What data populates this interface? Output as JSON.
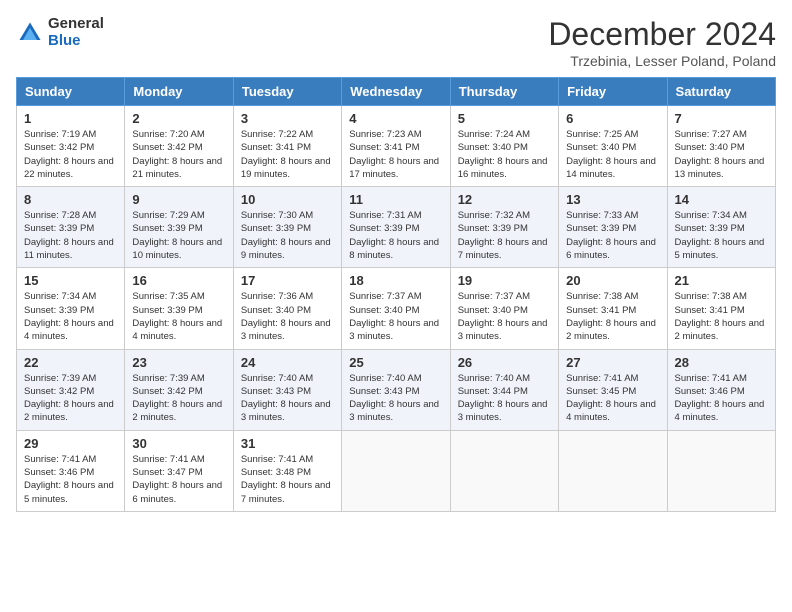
{
  "logo": {
    "general": "General",
    "blue": "Blue"
  },
  "title": "December 2024",
  "location": "Trzebinia, Lesser Poland, Poland",
  "days_of_week": [
    "Sunday",
    "Monday",
    "Tuesday",
    "Wednesday",
    "Thursday",
    "Friday",
    "Saturday"
  ],
  "weeks": [
    [
      {
        "day": 1,
        "sunrise": "7:19 AM",
        "sunset": "3:42 PM",
        "daylight": "8 hours and 22 minutes."
      },
      {
        "day": 2,
        "sunrise": "7:20 AM",
        "sunset": "3:42 PM",
        "daylight": "8 hours and 21 minutes."
      },
      {
        "day": 3,
        "sunrise": "7:22 AM",
        "sunset": "3:41 PM",
        "daylight": "8 hours and 19 minutes."
      },
      {
        "day": 4,
        "sunrise": "7:23 AM",
        "sunset": "3:41 PM",
        "daylight": "8 hours and 17 minutes."
      },
      {
        "day": 5,
        "sunrise": "7:24 AM",
        "sunset": "3:40 PM",
        "daylight": "8 hours and 16 minutes."
      },
      {
        "day": 6,
        "sunrise": "7:25 AM",
        "sunset": "3:40 PM",
        "daylight": "8 hours and 14 minutes."
      },
      {
        "day": 7,
        "sunrise": "7:27 AM",
        "sunset": "3:40 PM",
        "daylight": "8 hours and 13 minutes."
      }
    ],
    [
      {
        "day": 8,
        "sunrise": "7:28 AM",
        "sunset": "3:39 PM",
        "daylight": "8 hours and 11 minutes."
      },
      {
        "day": 9,
        "sunrise": "7:29 AM",
        "sunset": "3:39 PM",
        "daylight": "8 hours and 10 minutes."
      },
      {
        "day": 10,
        "sunrise": "7:30 AM",
        "sunset": "3:39 PM",
        "daylight": "8 hours and 9 minutes."
      },
      {
        "day": 11,
        "sunrise": "7:31 AM",
        "sunset": "3:39 PM",
        "daylight": "8 hours and 8 minutes."
      },
      {
        "day": 12,
        "sunrise": "7:32 AM",
        "sunset": "3:39 PM",
        "daylight": "8 hours and 7 minutes."
      },
      {
        "day": 13,
        "sunrise": "7:33 AM",
        "sunset": "3:39 PM",
        "daylight": "8 hours and 6 minutes."
      },
      {
        "day": 14,
        "sunrise": "7:34 AM",
        "sunset": "3:39 PM",
        "daylight": "8 hours and 5 minutes."
      }
    ],
    [
      {
        "day": 15,
        "sunrise": "7:34 AM",
        "sunset": "3:39 PM",
        "daylight": "8 hours and 4 minutes."
      },
      {
        "day": 16,
        "sunrise": "7:35 AM",
        "sunset": "3:39 PM",
        "daylight": "8 hours and 4 minutes."
      },
      {
        "day": 17,
        "sunrise": "7:36 AM",
        "sunset": "3:40 PM",
        "daylight": "8 hours and 3 minutes."
      },
      {
        "day": 18,
        "sunrise": "7:37 AM",
        "sunset": "3:40 PM",
        "daylight": "8 hours and 3 minutes."
      },
      {
        "day": 19,
        "sunrise": "7:37 AM",
        "sunset": "3:40 PM",
        "daylight": "8 hours and 3 minutes."
      },
      {
        "day": 20,
        "sunrise": "7:38 AM",
        "sunset": "3:41 PM",
        "daylight": "8 hours and 2 minutes."
      },
      {
        "day": 21,
        "sunrise": "7:38 AM",
        "sunset": "3:41 PM",
        "daylight": "8 hours and 2 minutes."
      }
    ],
    [
      {
        "day": 22,
        "sunrise": "7:39 AM",
        "sunset": "3:42 PM",
        "daylight": "8 hours and 2 minutes."
      },
      {
        "day": 23,
        "sunrise": "7:39 AM",
        "sunset": "3:42 PM",
        "daylight": "8 hours and 2 minutes."
      },
      {
        "day": 24,
        "sunrise": "7:40 AM",
        "sunset": "3:43 PM",
        "daylight": "8 hours and 3 minutes."
      },
      {
        "day": 25,
        "sunrise": "7:40 AM",
        "sunset": "3:43 PM",
        "daylight": "8 hours and 3 minutes."
      },
      {
        "day": 26,
        "sunrise": "7:40 AM",
        "sunset": "3:44 PM",
        "daylight": "8 hours and 3 minutes."
      },
      {
        "day": 27,
        "sunrise": "7:41 AM",
        "sunset": "3:45 PM",
        "daylight": "8 hours and 4 minutes."
      },
      {
        "day": 28,
        "sunrise": "7:41 AM",
        "sunset": "3:46 PM",
        "daylight": "8 hours and 4 minutes."
      }
    ],
    [
      {
        "day": 29,
        "sunrise": "7:41 AM",
        "sunset": "3:46 PM",
        "daylight": "8 hours and 5 minutes."
      },
      {
        "day": 30,
        "sunrise": "7:41 AM",
        "sunset": "3:47 PM",
        "daylight": "8 hours and 6 minutes."
      },
      {
        "day": 31,
        "sunrise": "7:41 AM",
        "sunset": "3:48 PM",
        "daylight": "8 hours and 7 minutes."
      },
      null,
      null,
      null,
      null
    ]
  ]
}
